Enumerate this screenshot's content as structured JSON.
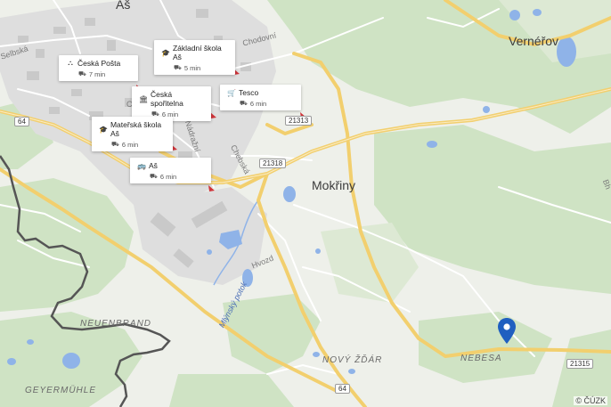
{
  "places": {
    "as": "Aš",
    "mokriny": "Mokřiny",
    "vernerov": "Vernéřov",
    "neuenbrand": "NEUENBRAND",
    "novy_zdar": "NOVÝ ŽĎÁR",
    "nebesa": "NEBESA",
    "geyermuhle": "GEYERMÜHLE"
  },
  "streets": {
    "selbska": "Selbská",
    "chodovni": "Chodovní",
    "nadrazni": "Nádražní",
    "chebska": "Chebská",
    "hvozd": "Hvozd",
    "mlynsky_potok": "Mlýnský potok",
    "bh": "Bh",
    "ch": "Ch"
  },
  "road_numbers": [
    "64",
    "21313",
    "21318",
    "21315",
    "64"
  ],
  "pois": [
    {
      "icon": "school-icon",
      "icon_glyph": "🎓",
      "name": "Základní škola Aš",
      "time": "5 min"
    },
    {
      "icon": "post-office-icon",
      "icon_glyph": "⛬",
      "name": "Česká Pošta",
      "time": "7 min"
    },
    {
      "icon": "bank-icon",
      "icon_glyph": "🏛",
      "name": "Česká spořitelna",
      "time": "6 min"
    },
    {
      "icon": "shop-icon",
      "icon_glyph": "🛒",
      "name": "Tesco",
      "time": "6 min"
    },
    {
      "icon": "school-icon",
      "icon_glyph": "🎓",
      "name": "Mateřská škola Aš",
      "time": "6 min"
    },
    {
      "icon": "bus-icon",
      "icon_glyph": "🚌",
      "name": "Aš",
      "time": "6 min"
    }
  ],
  "copyright": "© ČÚZK",
  "colors": {
    "land": "#eef0ea",
    "forest": "#cfe3c4",
    "urban": "#dcdcdc",
    "water": "#8fb3e8",
    "road_major": "#f5d67a",
    "road_minor": "#ffffff",
    "border": "#555555",
    "pin": "#1f5fc0",
    "arrow": "#d0343a"
  }
}
